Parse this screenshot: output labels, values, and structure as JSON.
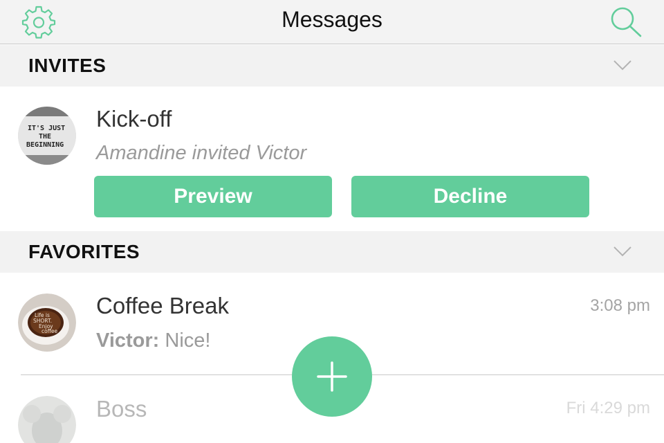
{
  "header": {
    "title": "Messages",
    "accent_color": "#62cd9b",
    "settings_icon": "gear-icon",
    "search_icon": "search-icon"
  },
  "invites": {
    "title": "INVITES",
    "items": [
      {
        "name": "Kick-off",
        "subtitle": "Amandine invited Victor",
        "avatar_text": [
          "IT'S JUST",
          "THE",
          "BEGINNING"
        ],
        "preview_label": "Preview",
        "decline_label": "Decline"
      }
    ]
  },
  "favorites": {
    "title": "FAVORITES",
    "items": [
      {
        "name": "Coffee Break",
        "sender": "Victor:",
        "message": " Nice!",
        "time": "3:08 pm",
        "avatar_text": [
          "Life is",
          "SHORT.",
          "Enjoy",
          "coffee"
        ]
      },
      {
        "name": "Boss",
        "time": "Fri 4:29 pm"
      }
    ]
  },
  "fab": {
    "icon": "plus-icon"
  }
}
